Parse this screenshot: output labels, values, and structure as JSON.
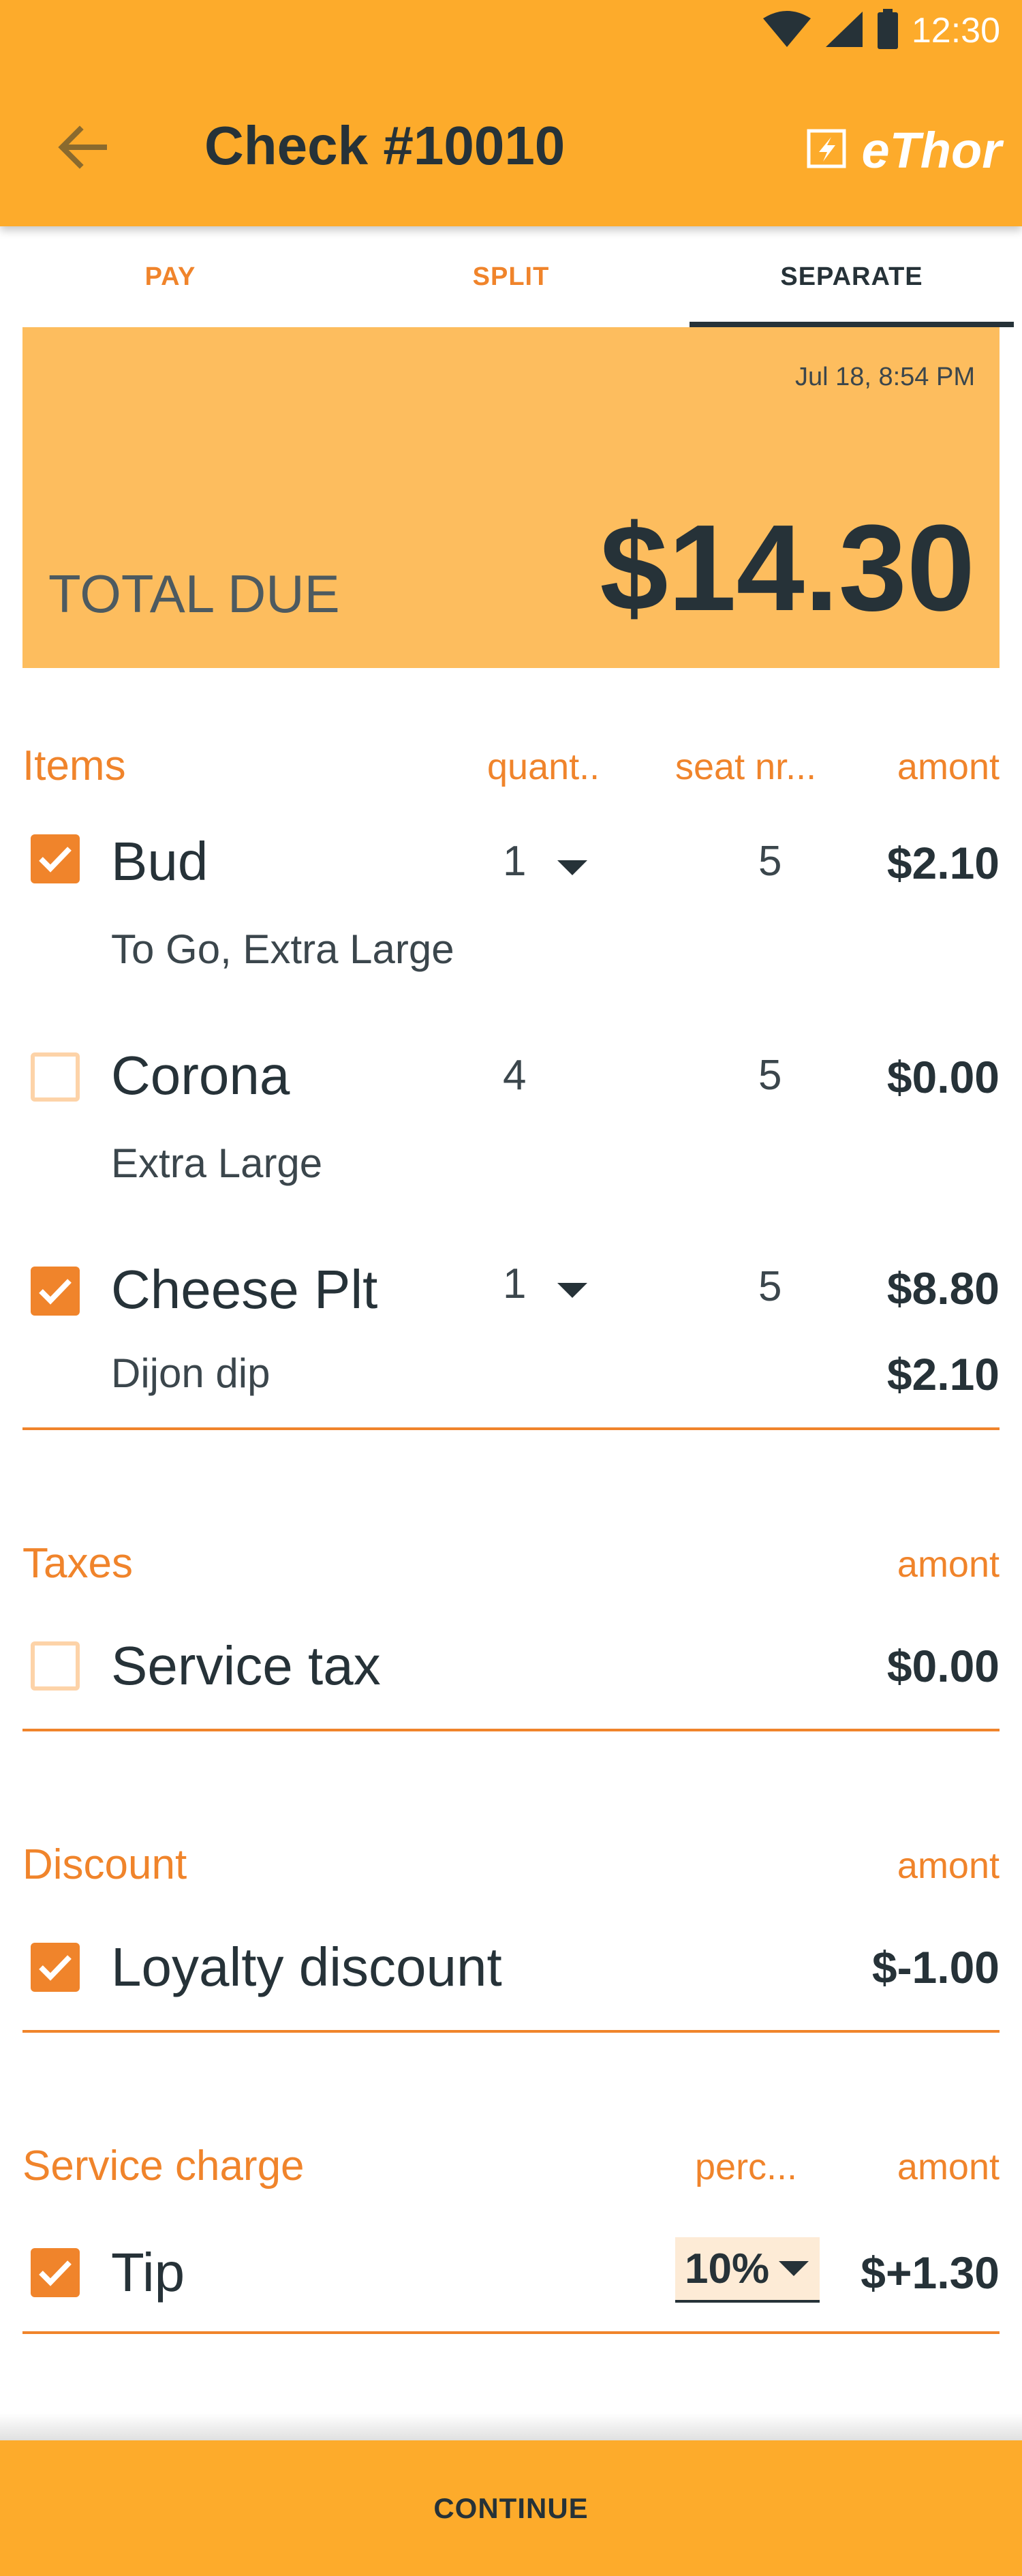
{
  "status_bar": {
    "time": "12:30"
  },
  "toolbar": {
    "title": "Check #10010",
    "brand": "eThor"
  },
  "tabs": [
    {
      "label": "PAY",
      "active": false
    },
    {
      "label": "SPLIT",
      "active": false
    },
    {
      "label": "SEPARATE",
      "active": true
    }
  ],
  "total": {
    "date": "Jul 18, 8:54 PM",
    "label": "TOTAL DUE",
    "amount": "$14.30"
  },
  "items_section": {
    "title": "Items",
    "col_qty": "quant..",
    "col_seat": "seat nr...",
    "col_amount": "amont",
    "rows": [
      {
        "name": "Bud",
        "sub": "To Go, Extra Large",
        "qty": "1",
        "seat": "5",
        "amount": "$2.10",
        "checked": true,
        "sub_amount": ""
      },
      {
        "name": "Corona",
        "sub": "Extra Large",
        "qty": "4",
        "seat": "5",
        "amount": "$0.00",
        "checked": false,
        "sub_amount": ""
      },
      {
        "name": "Cheese Plt",
        "sub": "Dijon dip",
        "qty": "1",
        "seat": "5",
        "amount": "$8.80",
        "checked": true,
        "sub_amount": "$2.10"
      }
    ]
  },
  "taxes_section": {
    "title": "Taxes",
    "col_amount": "amont",
    "rows": [
      {
        "name": "Service tax",
        "amount": "$0.00",
        "checked": false
      }
    ]
  },
  "discount_section": {
    "title": "Discount",
    "col_amount": "amont",
    "rows": [
      {
        "name": "Loyalty discount",
        "amount": "$-1.00",
        "checked": true
      }
    ]
  },
  "service_section": {
    "title": "Service charge",
    "col_percent": "perc...",
    "col_amount": "amont",
    "rows": [
      {
        "name": "Tip",
        "percent": "10%",
        "amount": "$+1.30",
        "checked": true
      }
    ]
  },
  "continue_label": "CONTINUE",
  "colors": {
    "accent": "#FDAB2B",
    "orange_text": "#F0842B",
    "card": "#FDBD5E",
    "dark": "#263238"
  }
}
